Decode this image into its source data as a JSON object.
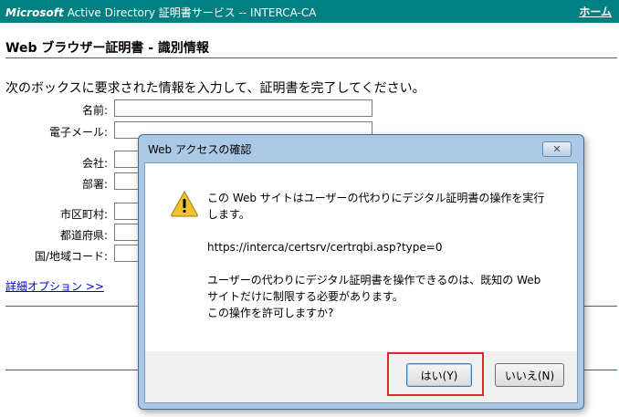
{
  "header": {
    "brand": "Microsoft",
    "title": "Active Directory 証明書サービス -- INTERCA-CA",
    "home_link": "ホーム",
    "color": "#008080"
  },
  "page": {
    "title": "Web ブラウザー証明書 - 識別情報",
    "intro": "次のボックスに要求された情報を入力して、証明書を完了してください。",
    "advanced_options_link": "詳細オプション >>",
    "fields": [
      {
        "label": "名前:",
        "value": ""
      },
      {
        "label": "電子メール:",
        "value": ""
      },
      {
        "label": "会社:",
        "value": ""
      },
      {
        "label": "部署:",
        "value": ""
      },
      {
        "label": "市区町村:",
        "value": ""
      },
      {
        "label": "都道府県:",
        "value": ""
      },
      {
        "label": "国/地域コード:",
        "value": ""
      }
    ]
  },
  "dialog": {
    "title": "Web アクセスの確認",
    "close_icon": "close-icon",
    "warning_icon": "warning-icon",
    "message_line1": "この Web サイトはユーザーの代わりにデジタル証明書の操作を実行",
    "message_line2": "します。",
    "url": "https://interca/certsrv/certrqbi.asp?type=0",
    "message2_line1": "ユーザーの代わりにデジタル証明書を操作できるのは、既知の Web",
    "message2_line2": "サイトだけに制限する必要があります。",
    "message2_line3": "この操作を許可しますか?",
    "yes_button": "はい(Y)",
    "no_button": "いいえ(N)",
    "highlight_color": "#e0262f"
  }
}
